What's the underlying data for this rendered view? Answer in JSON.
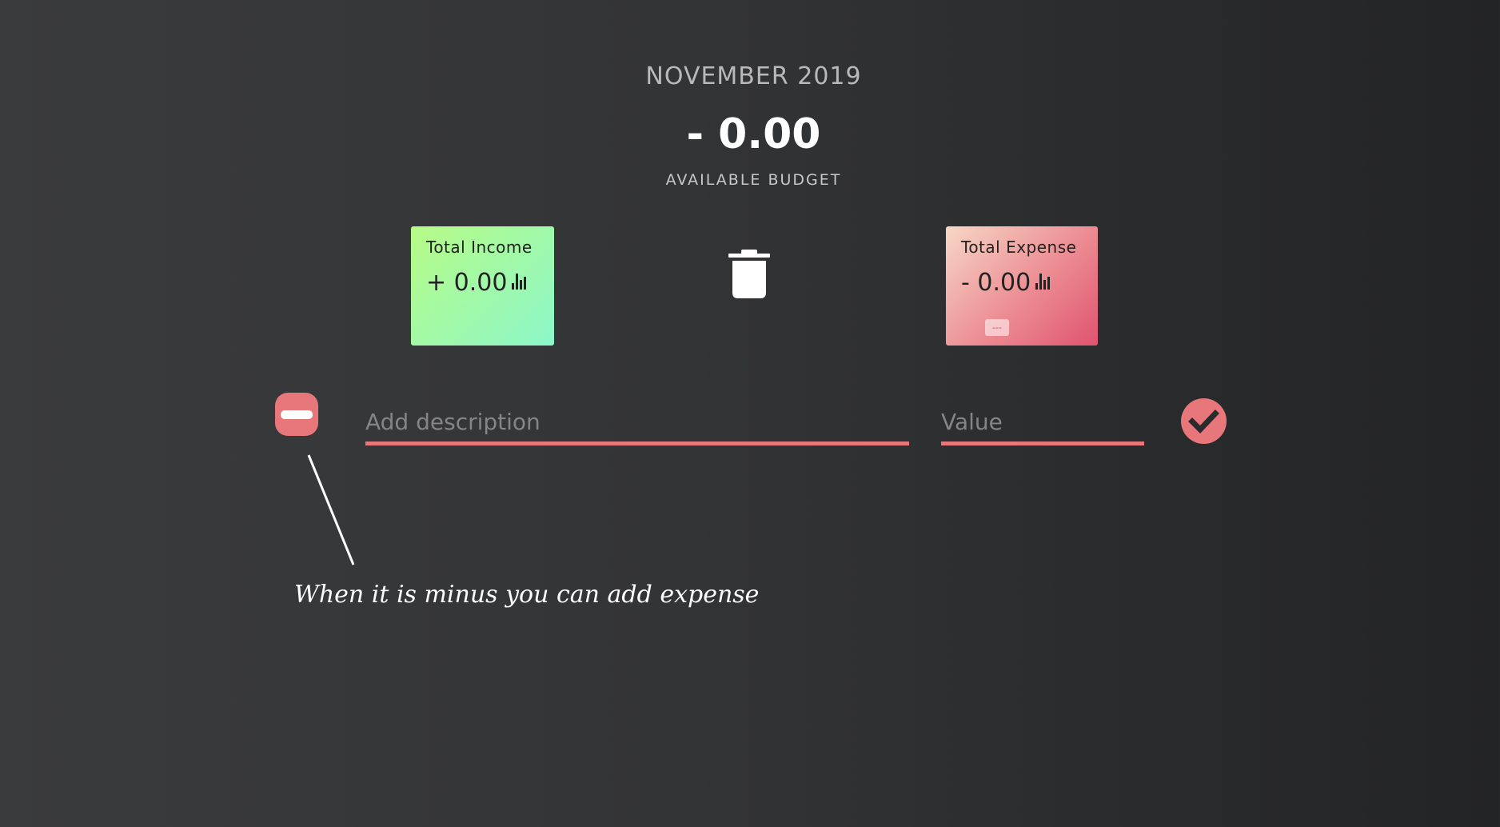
{
  "header": {
    "month": "NOVEMBER 2019",
    "budget_value": "- 0.00",
    "budget_label": "AVAILABLE BUDGET"
  },
  "income": {
    "title": "Total Income",
    "value": "+ 0.00",
    "icon": "bar-chart-icon"
  },
  "expense": {
    "title": "Total Expense",
    "value": "- 0.00",
    "percentage": "---",
    "icon": "bar-chart-icon"
  },
  "form": {
    "type_toggle": "minus-icon",
    "description_placeholder": "Add description",
    "value_placeholder": "Value",
    "submit_icon": "check-icon"
  },
  "annotation": {
    "text": "When it is minus you can add expense"
  },
  "colors": {
    "accent": "#e8777b",
    "income_gradient_start": "#b7fb86",
    "income_gradient_end": "#8cf7c9",
    "expense_gradient_start": "#f7d7c6",
    "expense_gradient_end": "#df5470"
  }
}
